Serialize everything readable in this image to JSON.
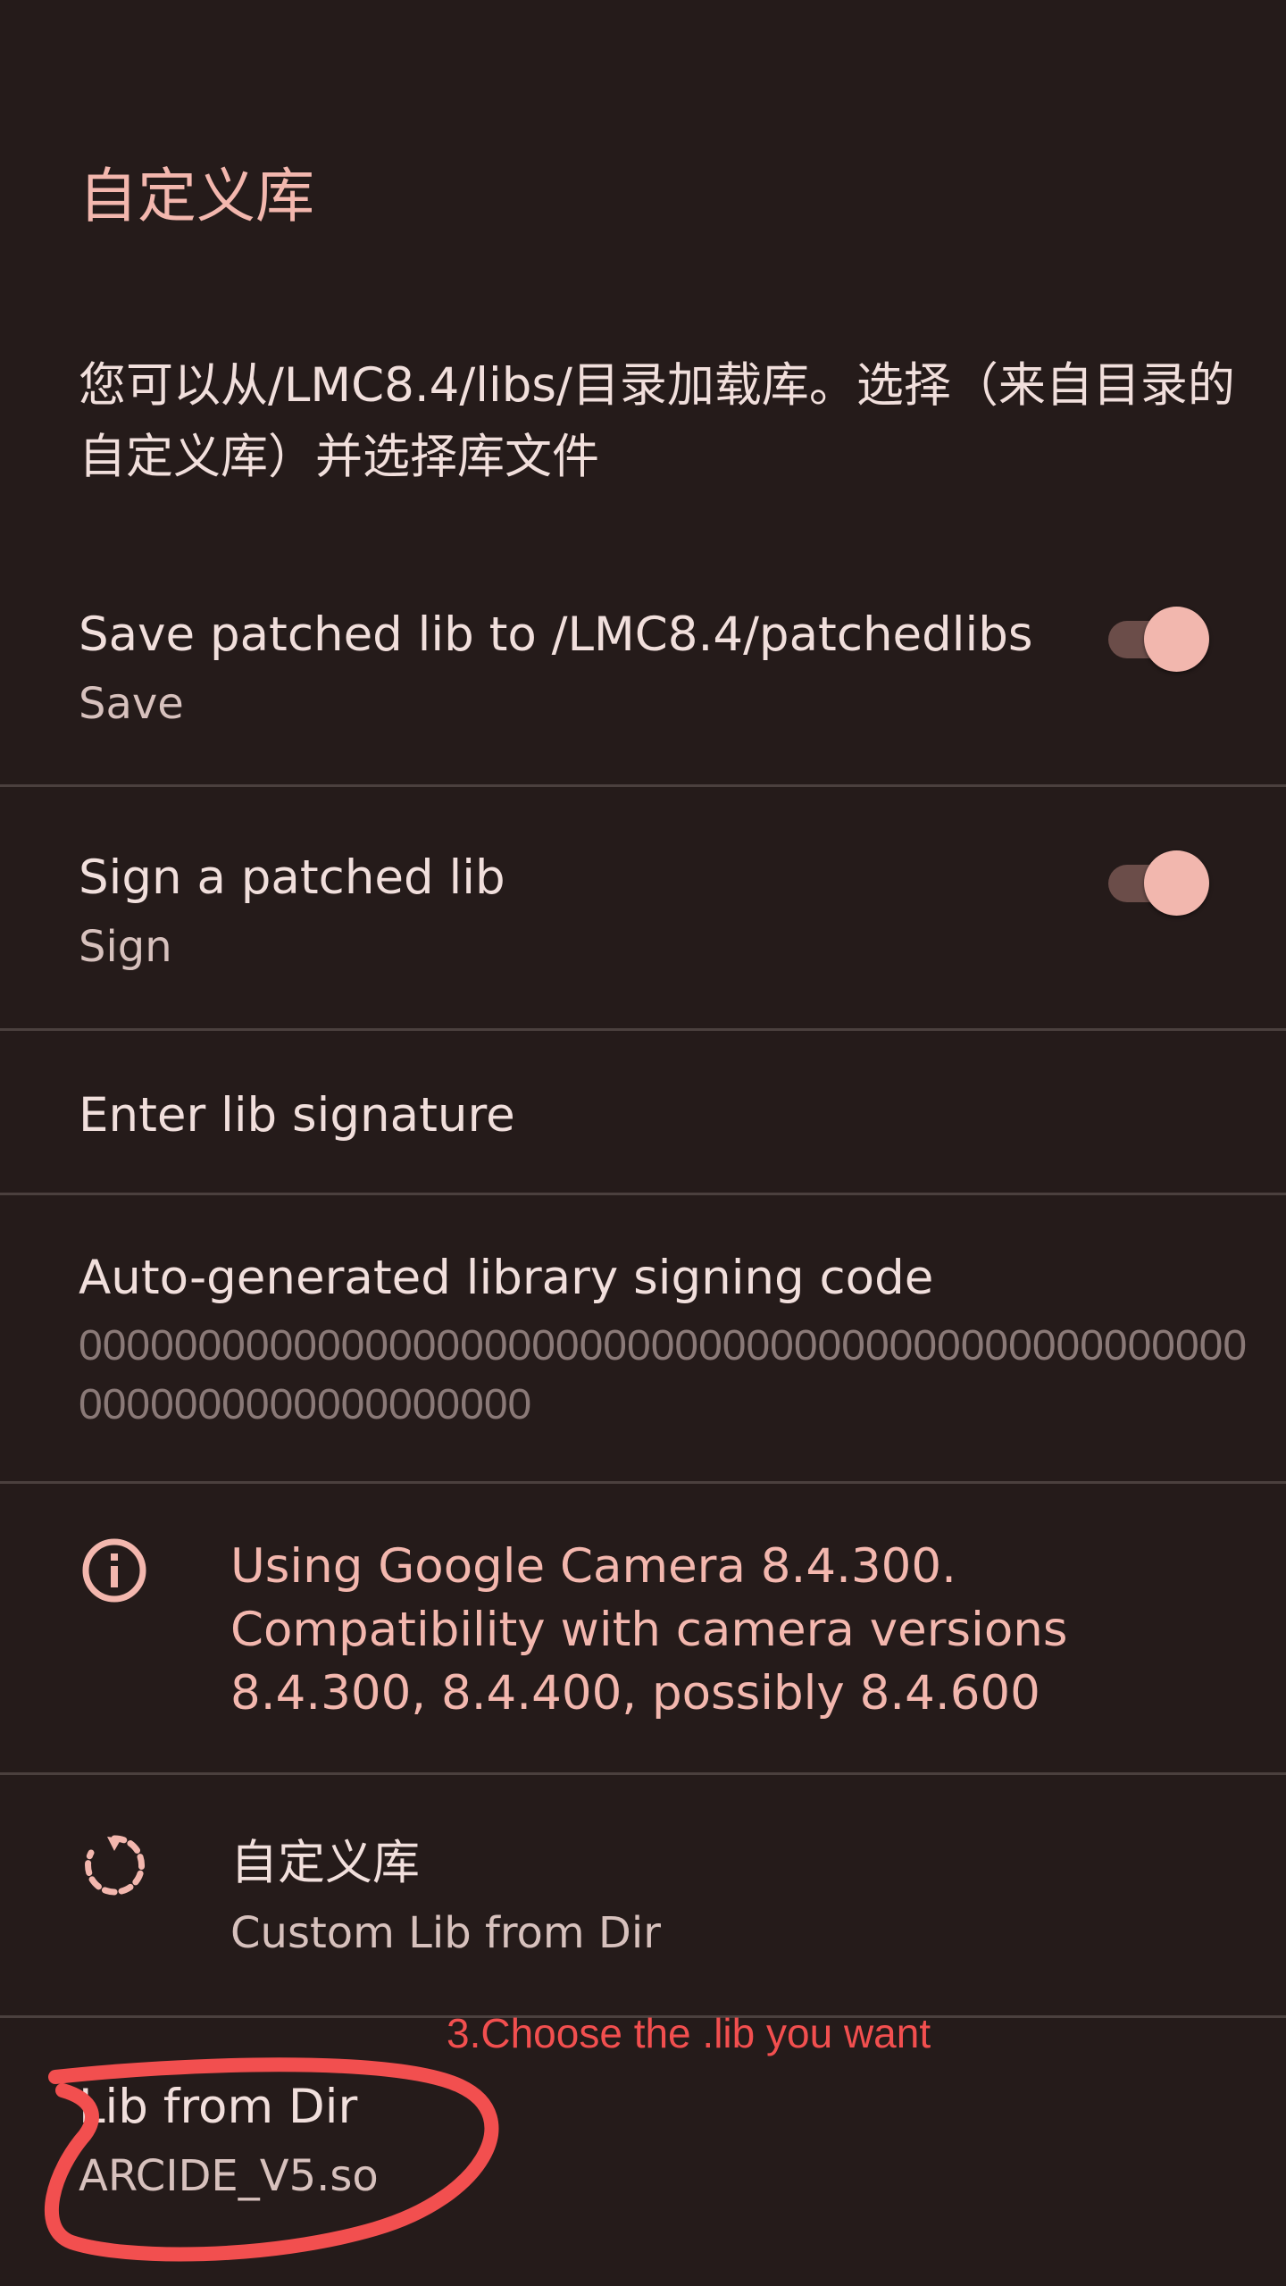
{
  "header": {
    "title": "自定义库"
  },
  "intro": {
    "text": "您可以从/LMC8.4/libs/目录加载库。选择（来自目录的自定义库）并选择库文件"
  },
  "settings": {
    "save_patched": {
      "title": "Save patched lib to /LMC8.4/patchedlibs",
      "summary": "Save",
      "enabled": true
    },
    "sign_patched": {
      "title": "Sign a patched lib",
      "summary": "Sign",
      "enabled": true
    },
    "enter_signature": {
      "title": "Enter lib signature"
    },
    "auto_signing": {
      "title": "Auto-generated library signing code",
      "code": "00000000000000000000000000000000000000000000000000000000000000000000"
    },
    "info": {
      "icon": "info-icon",
      "text": "Using Google Camera 8.4.300. Compatibility with camera versions 8.4.300, 8.4.400, possibly 8.4.600"
    },
    "custom_lib": {
      "icon": "refresh-icon",
      "title": "自定义库",
      "summary": "Custom Lib from Dir"
    },
    "lib_from_dir": {
      "title": "Lib from Dir",
      "summary": "ARCIDE_V5.so"
    }
  },
  "annotation": {
    "text": "3.Choose the .lib you want",
    "color": "#f24f4f"
  },
  "colors": {
    "background": "#251b1a",
    "accent": "#f3b7ae",
    "divider": "#4b403e"
  }
}
